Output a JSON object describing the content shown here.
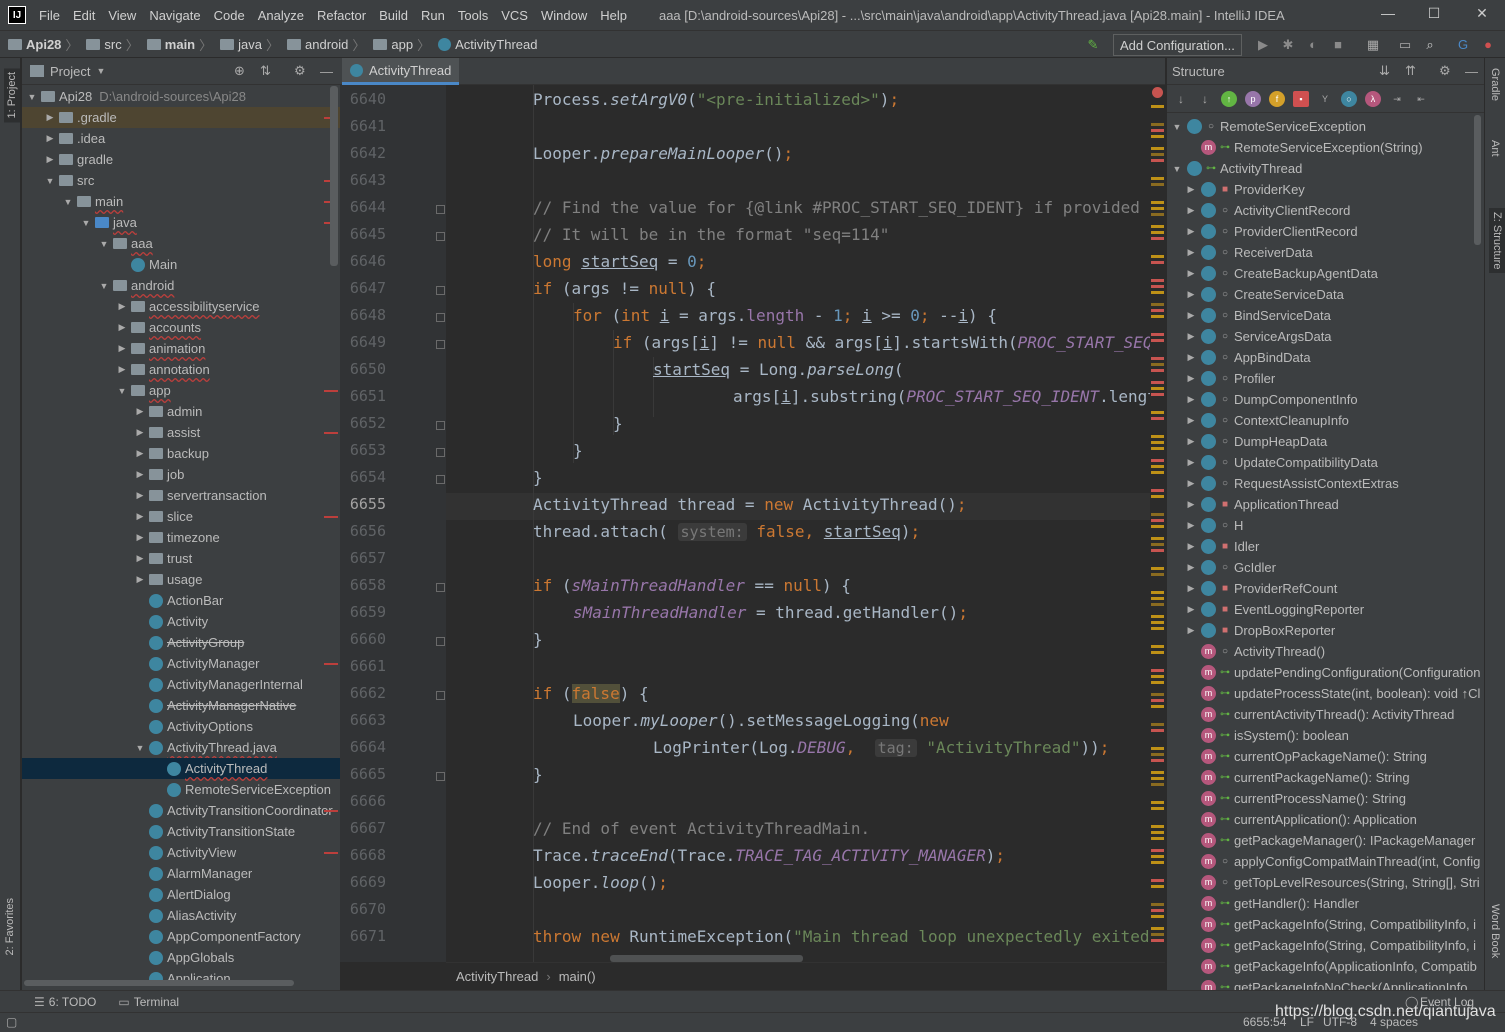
{
  "titlebar": {
    "logo": "IJ",
    "menu": [
      "File",
      "Edit",
      "View",
      "Navigate",
      "Code",
      "Analyze",
      "Refactor",
      "Build",
      "Run",
      "Tools",
      "VCS",
      "Window",
      "Help"
    ],
    "window_title": "aaa [D:\\android-sources\\Api28] - ...\\src\\main\\java\\android\\app\\ActivityThread.java [Api28.main] - IntelliJ IDEA",
    "controls": [
      "—",
      "☐",
      "✕"
    ]
  },
  "navbar": {
    "crumbs": [
      "Api28",
      "src",
      "main",
      "java",
      "android",
      "app",
      "ActivityThread"
    ],
    "add_config": "Add Configuration..."
  },
  "left_strip": {
    "project_tab": "1: Project",
    "favorites_tab": "2: Favorites"
  },
  "project": {
    "header": "Project",
    "root": {
      "name": "Api28",
      "path": "D:\\android-sources\\Api28"
    },
    "rows": [
      {
        "label": ".gradle",
        "depth": 1,
        "arrow": "▶",
        "icon": "folder"
      },
      {
        "label": ".idea",
        "depth": 1,
        "arrow": "▶",
        "icon": "folder"
      },
      {
        "label": "gradle",
        "depth": 1,
        "arrow": "▶",
        "icon": "folder"
      },
      {
        "label": "src",
        "depth": 1,
        "arrow": "▼",
        "icon": "folder"
      },
      {
        "label": "main",
        "depth": 2,
        "arrow": "▼",
        "icon": "folder"
      },
      {
        "label": "java",
        "depth": 3,
        "arrow": "▼",
        "icon": "folder-blue"
      },
      {
        "label": "aaa",
        "depth": 4,
        "arrow": "▼",
        "icon": "folder"
      },
      {
        "label": "Main",
        "depth": 5,
        "arrow": "",
        "icon": "class"
      },
      {
        "label": "android",
        "depth": 4,
        "arrow": "▼",
        "icon": "folder"
      },
      {
        "label": "accessibilityservice",
        "depth": 5,
        "arrow": "▶",
        "icon": "folder"
      },
      {
        "label": "accounts",
        "depth": 5,
        "arrow": "▶",
        "icon": "folder"
      },
      {
        "label": "animation",
        "depth": 5,
        "arrow": "▶",
        "icon": "folder"
      },
      {
        "label": "annotation",
        "depth": 5,
        "arrow": "▶",
        "icon": "folder"
      },
      {
        "label": "app",
        "depth": 5,
        "arrow": "▼",
        "icon": "folder"
      },
      {
        "label": "admin",
        "depth": 6,
        "arrow": "▶",
        "icon": "folder"
      },
      {
        "label": "assist",
        "depth": 6,
        "arrow": "▶",
        "icon": "folder"
      },
      {
        "label": "backup",
        "depth": 6,
        "arrow": "▶",
        "icon": "folder"
      },
      {
        "label": "job",
        "depth": 6,
        "arrow": "▶",
        "icon": "folder"
      },
      {
        "label": "servertransaction",
        "depth": 6,
        "arrow": "▶",
        "icon": "folder"
      },
      {
        "label": "slice",
        "depth": 6,
        "arrow": "▶",
        "icon": "folder"
      },
      {
        "label": "timezone",
        "depth": 6,
        "arrow": "▶",
        "icon": "folder"
      },
      {
        "label": "trust",
        "depth": 6,
        "arrow": "▶",
        "icon": "folder"
      },
      {
        "label": "usage",
        "depth": 6,
        "arrow": "▶",
        "icon": "folder"
      },
      {
        "label": "ActionBar",
        "depth": 6,
        "arrow": "",
        "icon": "class"
      },
      {
        "label": "Activity",
        "depth": 6,
        "arrow": "",
        "icon": "class"
      },
      {
        "label": "ActivityGroup",
        "depth": 6,
        "arrow": "",
        "icon": "class",
        "style": "strike"
      },
      {
        "label": "ActivityManager",
        "depth": 6,
        "arrow": "",
        "icon": "class"
      },
      {
        "label": "ActivityManagerInternal",
        "depth": 6,
        "arrow": "",
        "icon": "class"
      },
      {
        "label": "ActivityManagerNative",
        "depth": 6,
        "arrow": "",
        "icon": "class",
        "style": "strike"
      },
      {
        "label": "ActivityOptions",
        "depth": 6,
        "arrow": "",
        "icon": "class"
      },
      {
        "label": "ActivityThread.java",
        "depth": 6,
        "arrow": "▼",
        "icon": "class"
      },
      {
        "label": "ActivityThread",
        "depth": 7,
        "arrow": "",
        "icon": "class",
        "style": "selected"
      },
      {
        "label": "RemoteServiceException",
        "depth": 7,
        "arrow": "",
        "icon": "class"
      },
      {
        "label": "ActivityTransitionCoordinator",
        "depth": 6,
        "arrow": "",
        "icon": "class"
      },
      {
        "label": "ActivityTransitionState",
        "depth": 6,
        "arrow": "",
        "icon": "class"
      },
      {
        "label": "ActivityView",
        "depth": 6,
        "arrow": "",
        "icon": "class"
      },
      {
        "label": "AlarmManager",
        "depth": 6,
        "arrow": "",
        "icon": "class"
      },
      {
        "label": "AlertDialog",
        "depth": 6,
        "arrow": "",
        "icon": "class"
      },
      {
        "label": "AliasActivity",
        "depth": 6,
        "arrow": "",
        "icon": "class"
      },
      {
        "label": "AppComponentFactory",
        "depth": 6,
        "arrow": "",
        "icon": "class"
      },
      {
        "label": "AppGlobals",
        "depth": 6,
        "arrow": "",
        "icon": "class"
      },
      {
        "label": "Application",
        "depth": 6,
        "arrow": "",
        "icon": "class"
      }
    ]
  },
  "editor": {
    "tab": "ActivityThread",
    "current_line": "6655",
    "line_numbers": [
      "6640",
      "6641",
      "6642",
      "6643",
      "6644",
      "6645",
      "6646",
      "6647",
      "6648",
      "6649",
      "6650",
      "6651",
      "6652",
      "6653",
      "6654",
      "6655",
      "6656",
      "6657",
      "6658",
      "6659",
      "6660",
      "6661",
      "6662",
      "6663",
      "6664",
      "6665",
      "6666",
      "6667",
      "6668",
      "6669",
      "6670",
      "6671"
    ],
    "hints": {
      "system": "system:",
      "tag": "tag:"
    },
    "breadcrumb": [
      "ActivityThread",
      "main()"
    ]
  },
  "structure": {
    "header": "Structure",
    "rows": [
      {
        "label": "RemoteServiceException",
        "arrow": "▼",
        "icon": "class",
        "vis": "○",
        "indent": 0
      },
      {
        "label": "RemoteServiceException(String)",
        "arrow": "",
        "icon": "method",
        "vis": "⊶",
        "indent": 1
      },
      {
        "label": "ActivityThread",
        "arrow": "▼",
        "icon": "class",
        "vis": "⊶",
        "indent": 0
      },
      {
        "label": "ProviderKey",
        "arrow": "▶",
        "icon": "class",
        "vis": "🔒",
        "indent": 1
      },
      {
        "label": "ActivityClientRecord",
        "arrow": "▶",
        "icon": "class",
        "vis": "○",
        "indent": 1
      },
      {
        "label": "ProviderClientRecord",
        "arrow": "▶",
        "icon": "class",
        "vis": "○",
        "indent": 1
      },
      {
        "label": "ReceiverData",
        "arrow": "▶",
        "icon": "class",
        "vis": "○",
        "indent": 1
      },
      {
        "label": "CreateBackupAgentData",
        "arrow": "▶",
        "icon": "class",
        "vis": "○",
        "indent": 1
      },
      {
        "label": "CreateServiceData",
        "arrow": "▶",
        "icon": "class",
        "vis": "○",
        "indent": 1
      },
      {
        "label": "BindServiceData",
        "arrow": "▶",
        "icon": "class",
        "vis": "○",
        "indent": 1
      },
      {
        "label": "ServiceArgsData",
        "arrow": "▶",
        "icon": "class",
        "vis": "○",
        "indent": 1
      },
      {
        "label": "AppBindData",
        "arrow": "▶",
        "icon": "class",
        "vis": "○",
        "indent": 1
      },
      {
        "label": "Profiler",
        "arrow": "▶",
        "icon": "class",
        "vis": "○",
        "indent": 1
      },
      {
        "label": "DumpComponentInfo",
        "arrow": "▶",
        "icon": "class",
        "vis": "○",
        "indent": 1
      },
      {
        "label": "ContextCleanupInfo",
        "arrow": "▶",
        "icon": "class",
        "vis": "○",
        "indent": 1
      },
      {
        "label": "DumpHeapData",
        "arrow": "▶",
        "icon": "class",
        "vis": "○",
        "indent": 1
      },
      {
        "label": "UpdateCompatibilityData",
        "arrow": "▶",
        "icon": "class",
        "vis": "○",
        "indent": 1
      },
      {
        "label": "RequestAssistContextExtras",
        "arrow": "▶",
        "icon": "class",
        "vis": "○",
        "indent": 1
      },
      {
        "label": "ApplicationThread",
        "arrow": "▶",
        "icon": "class",
        "vis": "🔒",
        "indent": 1
      },
      {
        "label": "H",
        "arrow": "▶",
        "icon": "class",
        "vis": "○",
        "indent": 1
      },
      {
        "label": "Idler",
        "arrow": "▶",
        "icon": "class",
        "vis": "🔒",
        "indent": 1
      },
      {
        "label": "GcIdler",
        "arrow": "▶",
        "icon": "class",
        "vis": "○",
        "indent": 1
      },
      {
        "label": "ProviderRefCount",
        "arrow": "▶",
        "icon": "class",
        "vis": "🔒",
        "indent": 1
      },
      {
        "label": "EventLoggingReporter",
        "arrow": "▶",
        "icon": "class",
        "vis": "🔒",
        "indent": 1
      },
      {
        "label": "DropBoxReporter",
        "arrow": "▶",
        "icon": "class",
        "vis": "🔒",
        "indent": 1
      },
      {
        "label": "ActivityThread()",
        "arrow": "",
        "icon": "method",
        "vis": "○",
        "indent": 1
      },
      {
        "label": "updatePendingConfiguration(Configuration",
        "arrow": "",
        "icon": "method",
        "vis": "⊶",
        "indent": 1
      },
      {
        "label": "updateProcessState(int, boolean): void ↑Cl",
        "arrow": "",
        "icon": "method",
        "vis": "⊶",
        "indent": 1
      },
      {
        "label": "currentActivityThread(): ActivityThread",
        "arrow": "",
        "icon": "method",
        "vis": "⊶",
        "indent": 1
      },
      {
        "label": "isSystem(): boolean",
        "arrow": "",
        "icon": "method",
        "vis": "⊶",
        "indent": 1
      },
      {
        "label": "currentOpPackageName(): String",
        "arrow": "",
        "icon": "method",
        "vis": "⊶",
        "indent": 1
      },
      {
        "label": "currentPackageName(): String",
        "arrow": "",
        "icon": "method",
        "vis": "⊶",
        "indent": 1
      },
      {
        "label": "currentProcessName(): String",
        "arrow": "",
        "icon": "method",
        "vis": "⊶",
        "indent": 1
      },
      {
        "label": "currentApplication(): Application",
        "arrow": "",
        "icon": "method",
        "vis": "⊶",
        "indent": 1
      },
      {
        "label": "getPackageManager(): IPackageManager",
        "arrow": "",
        "icon": "method",
        "vis": "⊶",
        "indent": 1
      },
      {
        "label": "applyConfigCompatMainThread(int, Config",
        "arrow": "",
        "icon": "method",
        "vis": "○",
        "indent": 1
      },
      {
        "label": "getTopLevelResources(String, String[], Stri",
        "arrow": "",
        "icon": "method",
        "vis": "○",
        "indent": 1
      },
      {
        "label": "getHandler(): Handler",
        "arrow": "",
        "icon": "method",
        "vis": "⊶",
        "indent": 1
      },
      {
        "label": "getPackageInfo(String, CompatibilityInfo, i",
        "arrow": "",
        "icon": "method",
        "vis": "⊶",
        "indent": 1
      },
      {
        "label": "getPackageInfo(String, CompatibilityInfo, i",
        "arrow": "",
        "icon": "method",
        "vis": "⊶",
        "indent": 1
      },
      {
        "label": "getPackageInfo(ApplicationInfo, Compatib",
        "arrow": "",
        "icon": "method",
        "vis": "⊶",
        "indent": 1
      },
      {
        "label": "getPackageInfoNoCheck(ApplicationInfo,",
        "arrow": "",
        "icon": "method",
        "vis": "⊶",
        "indent": 1
      }
    ]
  },
  "right_strip": {
    "tabs": [
      "Gradle",
      "Ant",
      "Z: Structure",
      "Word Book"
    ]
  },
  "bottom_tools": {
    "todo": "6: TODO",
    "terminal": "Terminal",
    "event_log": "Event Log"
  },
  "status": {
    "position": "6655:54",
    "line_sep": "LF",
    "encoding": "UTF-8",
    "indent": "4 spaces"
  },
  "watermark": "https://blog.csdn.net/qiantujava",
  "colors": {
    "keyword": "#cc7832",
    "string": "#6a8759",
    "number": "#6897bb",
    "constant": "#9876aa",
    "selection": "#0d293e",
    "accent": "#4a88c7"
  }
}
